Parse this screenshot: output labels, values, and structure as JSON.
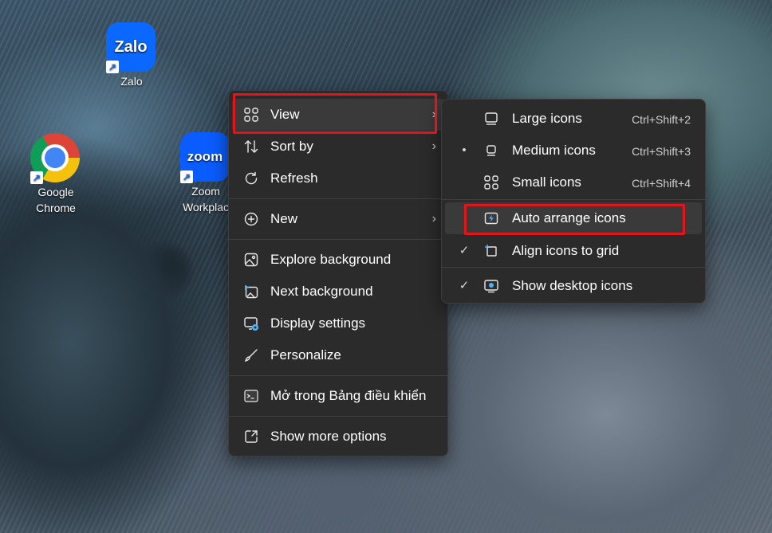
{
  "desktop": {
    "icons": [
      {
        "label": "Zalo",
        "tile": "Zalo",
        "icon": "zalo-app-icon"
      },
      {
        "label": "Google Chrome",
        "line1": "Google",
        "line2": "Chrome",
        "icon": "chrome-app-icon"
      },
      {
        "label": "Zoom Workplace",
        "line1": "Zoom",
        "line2": "Workplac",
        "tile": "zoom",
        "icon": "zoom-app-icon"
      }
    ],
    "shortcut_glyph": "↗"
  },
  "context_menu": {
    "items": [
      {
        "label": "View",
        "icon": "grid-icon",
        "submenu": true
      },
      {
        "label": "Sort by",
        "icon": "sort-icon",
        "submenu": true
      },
      {
        "label": "Refresh",
        "icon": "refresh-icon"
      },
      {
        "label": "New",
        "icon": "plus-circle-icon",
        "submenu": true
      },
      {
        "label": "Explore background",
        "icon": "image-icon"
      },
      {
        "label": "Next background",
        "icon": "next-image-icon"
      },
      {
        "label": "Display settings",
        "icon": "display-settings-icon"
      },
      {
        "label": "Personalize",
        "icon": "brush-icon"
      },
      {
        "label": "Mở trong Bảng điều khiển",
        "icon": "terminal-icon"
      },
      {
        "label": "Show more options",
        "icon": "expand-icon"
      }
    ],
    "submenu_arrow": "›"
  },
  "view_submenu": {
    "items": [
      {
        "label": "Large icons",
        "shortcut": "Ctrl+Shift+2",
        "mark": "",
        "icon": "large-icons-icon"
      },
      {
        "label": "Medium icons",
        "shortcut": "Ctrl+Shift+3",
        "mark": "•",
        "icon": "medium-icons-icon"
      },
      {
        "label": "Small icons",
        "shortcut": "Ctrl+Shift+4",
        "mark": "",
        "icon": "small-icons-icon"
      },
      {
        "label": "Auto arrange icons",
        "mark": "",
        "icon": "auto-arrange-icon"
      },
      {
        "label": "Align icons to grid",
        "mark": "✓",
        "icon": "align-grid-icon"
      },
      {
        "label": "Show desktop icons",
        "mark": "✓",
        "icon": "show-desktop-icon"
      }
    ]
  },
  "colors": {
    "highlight": "#e3151a",
    "menu_bg": "#2b2b2b",
    "accent": "#4fb2ff"
  }
}
